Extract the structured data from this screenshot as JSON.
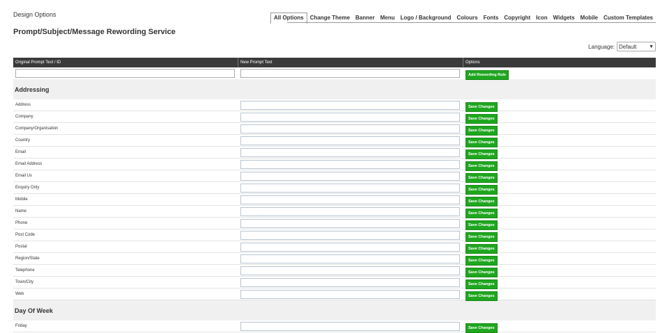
{
  "header": {
    "design_options": "Design Options",
    "page_title": "Prompt/Subject/Message Rewording Service"
  },
  "tabs": [
    {
      "label": "All Options",
      "active": true
    },
    {
      "label": "Change Theme"
    },
    {
      "label": "Banner"
    },
    {
      "label": "Menu"
    },
    {
      "label": "Logo / Background"
    },
    {
      "label": "Colours"
    },
    {
      "label": "Fonts"
    },
    {
      "label": "Copyright"
    },
    {
      "label": "Icon"
    },
    {
      "label": "Widgets"
    },
    {
      "label": "Mobile"
    },
    {
      "label": "Custom Templates"
    }
  ],
  "language": {
    "label": "Language:",
    "selected": "Default"
  },
  "table": {
    "headers": [
      "Original Prompt Text / ID",
      "New Prompt Text",
      "Options"
    ],
    "new_rule": {
      "original_value": "",
      "new_value": "",
      "button": "Add Rewording Rule"
    },
    "save_label": "Save Changes",
    "sections": [
      {
        "title": "Addressing",
        "rows": [
          "Address",
          "Company",
          "Company/Organisation",
          "Country",
          "Email",
          "Email Address",
          "Email Us",
          "Enquiry Only",
          "Mobile",
          "Name",
          "Phone",
          "Post Code",
          "Postal",
          "Region/State",
          "Telephone",
          "Town/City",
          "Web"
        ]
      },
      {
        "title": "Day Of Week",
        "rows": [
          "Friday"
        ]
      }
    ]
  },
  "colors": {
    "header_bg": "#3a3a3a",
    "button_green": "#1fa61f",
    "section_bg": "#f0f0f0"
  }
}
